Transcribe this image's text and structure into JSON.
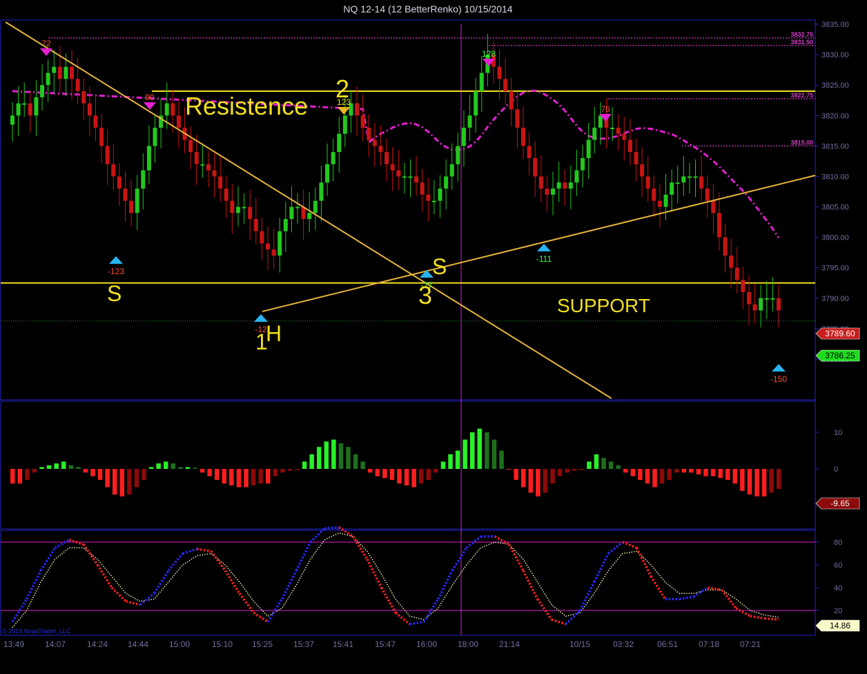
{
  "title": "NQ 12-14 (12 BetterRenko)  10/15/2014",
  "copyright": "© 2014 NinjaTrader, LLC",
  "colors": {
    "background": "#000000",
    "border": "#2424c8",
    "axis_text": "#7070a0",
    "up_candle": "#22c81e",
    "down_candle": "#c81414",
    "annotation": "#f0e020",
    "trendline": "#e8b43c",
    "vwap": "#e61ed2",
    "level_line": "#d23cc8",
    "marker_up": "#28b4f0",
    "marker_down": "#e61ed2",
    "histo_up_bright": "#28f028",
    "histo_up_dark": "#1e6e1e",
    "histo_down_bright": "#ff1e1e",
    "histo_down_dark": "#8c0a0a",
    "stoch_k_up": "#2828ff",
    "stoch_k_down": "#ff2020",
    "stoch_d": "#f0f0b4"
  },
  "annotations": {
    "resistance": "Resistence",
    "support": "SUPPORT",
    "s_left": "S",
    "s_mid": "S",
    "n1": "1",
    "h": "H",
    "n2": "2",
    "n3": "3"
  },
  "markers": {
    "m72": "72",
    "m90": "90",
    "m123": "123",
    "m128": "128",
    "m76": "76",
    "mneg123": "-123",
    "mneg12x": "-12",
    "mneg27": "-27",
    "mneg111": "-111",
    "mneg150": "-150"
  },
  "level_labels": {
    "l3832": "3832.75",
    "l3831": "3831.50",
    "l3822": "3822.75",
    "l3815": "3815.00"
  },
  "price_tags": {
    "last": "3789.60",
    "current": "3786.25",
    "histo": "-9.65",
    "stoch": "14.86"
  },
  "chart_data": {
    "type": "candlestick",
    "price_ticks": [
      "3835.00",
      "3830.00",
      "3825.00",
      "3820.00",
      "3815.00",
      "3810.00",
      "3805.00",
      "3800.00",
      "3795.00",
      "3790.00",
      "3785.00",
      "3780.00"
    ],
    "price_ylim": [
      3780,
      3835
    ],
    "histo_ticks": [
      "10",
      "0",
      "-10"
    ],
    "stoch_ticks": [
      "80",
      "60",
      "40",
      "20"
    ],
    "stoch_ylim": [
      0,
      100
    ],
    "x_labels": [
      "13:49",
      "14:07",
      "14:24",
      "14:44",
      "15:00",
      "15:10",
      "15:25",
      "15:37",
      "15:41",
      "15:47",
      "16:00",
      "18:00",
      "21:14",
      "10/15",
      "03:32",
      "06:51",
      "07:18",
      "07:21"
    ],
    "levels": {
      "resistance": 3824,
      "support": 3792.5,
      "dotted_3832_75": 3832.75,
      "dotted_3831_50": 3831.5,
      "dotted_3822_75": 3822.75,
      "dotted_3815_00": 3815.0
    },
    "closes": [
      3820,
      3822,
      3822,
      3820,
      3823,
      3825,
      3827,
      3828,
      3826,
      3828,
      3826,
      3824,
      3822,
      3820,
      3818,
      3815,
      3812,
      3810,
      3808,
      3806,
      3804,
      3808,
      3811,
      3815,
      3818,
      3820,
      3822,
      3820,
      3818,
      3816,
      3814,
      3812,
      3812,
      3811,
      3810,
      3808,
      3806,
      3804,
      3805,
      3805,
      3803,
      3801,
      3799,
      3798,
      3797,
      3801,
      3803,
      3805,
      3805,
      3803,
      3804,
      3806,
      3809,
      3812,
      3814,
      3817,
      3820,
      3822,
      3820,
      3818,
      3816,
      3815,
      3814,
      3812,
      3811,
      3810,
      3810,
      3810,
      3809,
      3807,
      3806,
      3806,
      3808,
      3810,
      3812,
      3815,
      3818,
      3820,
      3824,
      3827,
      3830,
      3828,
      3826,
      3824,
      3821,
      3818,
      3815,
      3813,
      3810,
      3808,
      3807,
      3808,
      3809,
      3808,
      3809,
      3811,
      3813,
      3816,
      3818,
      3820,
      3818,
      3818,
      3817,
      3816,
      3814,
      3812,
      3810,
      3808,
      3806,
      3805,
      3807,
      3809,
      3809,
      3810,
      3810,
      3810,
      3808,
      3806,
      3804,
      3800,
      3797,
      3795,
      3793,
      3791,
      3789,
      3788,
      3790,
      3790,
      3790,
      3788
    ],
    "histogram": [
      -4,
      -4,
      -3,
      -1,
      0.5,
      1,
      1.5,
      2,
      1,
      0.5,
      -1,
      -2,
      -3,
      -5,
      -7,
      -7.5,
      -7,
      -5,
      -3,
      0.5,
      1.5,
      2,
      1.5,
      0.5,
      0.5,
      0.3,
      -1,
      -2,
      -3,
      -4,
      -4.5,
      -5,
      -5,
      -4.5,
      -4,
      -4,
      -2,
      -1,
      -0.5,
      -0.3,
      2,
      4,
      6,
      7.5,
      8,
      7,
      6,
      4,
      2,
      -1,
      -2,
      -2.5,
      -3,
      -4,
      -4.5,
      -5,
      -4,
      -3,
      -1,
      2,
      4,
      5,
      8,
      10,
      11,
      10,
      8,
      5,
      -0.2,
      -3,
      -5,
      -6.5,
      -7.5,
      -6.5,
      -4,
      -2,
      -1,
      -0.5,
      -0.3,
      2,
      4,
      3,
      2,
      1,
      -1,
      -2,
      -3,
      -4,
      -5,
      -4,
      -3,
      -1,
      -1,
      -1,
      -1.5,
      -2,
      -2,
      -2.5,
      -3,
      -4,
      -6,
      -7,
      -7.5,
      -7.5,
      -6.5,
      -5.5
    ],
    "stoch_k": [
      10,
      30,
      55,
      75,
      82,
      78,
      60,
      40,
      28,
      25,
      35,
      55,
      70,
      74,
      72,
      55,
      35,
      18,
      10,
      30,
      55,
      80,
      92,
      93,
      85,
      65,
      40,
      18,
      8,
      10,
      30,
      55,
      75,
      85,
      85,
      78,
      55,
      30,
      12,
      8,
      20,
      45,
      70,
      80,
      75,
      50,
      30,
      30,
      32,
      40,
      38,
      22,
      15,
      13,
      12
    ],
    "stoch_d": [
      5,
      20,
      45,
      65,
      75,
      75,
      65,
      50,
      35,
      28,
      30,
      45,
      60,
      68,
      70,
      60,
      45,
      28,
      15,
      22,
      42,
      65,
      82,
      88,
      85,
      72,
      52,
      30,
      15,
      12,
      22,
      42,
      60,
      75,
      80,
      78,
      65,
      45,
      25,
      15,
      18,
      35,
      55,
      70,
      72,
      60,
      45,
      35,
      35,
      38,
      38,
      30,
      20,
      16,
      14
    ]
  }
}
